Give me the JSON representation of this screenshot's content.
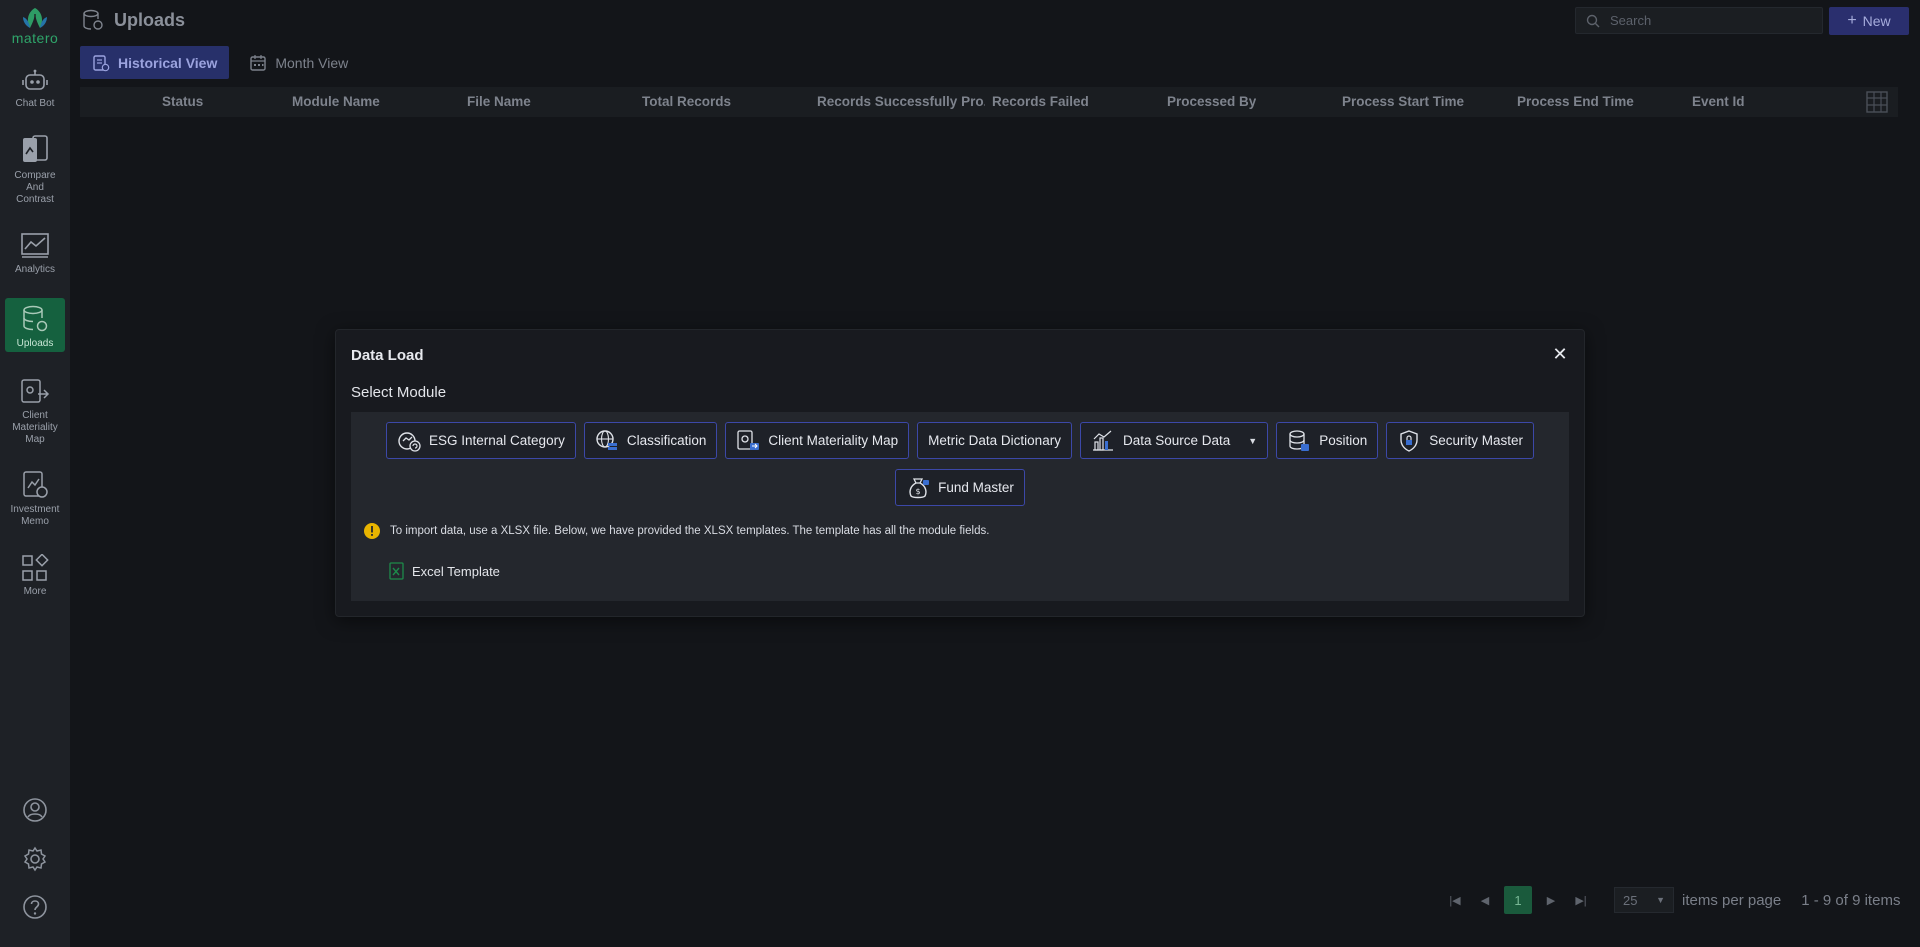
{
  "app": {
    "logo_text": "matero"
  },
  "sidebar": {
    "items": [
      {
        "label": "Chat Bot"
      },
      {
        "label": "Compare And Contrast"
      },
      {
        "label": "Analytics"
      },
      {
        "label": "Uploads"
      },
      {
        "label": "Client Materiality Map"
      },
      {
        "label": "Investment Memo"
      },
      {
        "label": "More"
      }
    ],
    "active": "Uploads"
  },
  "header": {
    "title": "Uploads",
    "search_placeholder": "Search",
    "new_label": "New"
  },
  "tabs": [
    {
      "label": "Historical View",
      "active": true
    },
    {
      "label": "Month View",
      "active": false
    }
  ],
  "grid": {
    "columns": [
      "Status",
      "Module Name",
      "File Name",
      "Total Records",
      "Records Successfully Pro...",
      "Records Failed",
      "Processed By",
      "Process Start Time",
      "Process End Time",
      "Event Id"
    ]
  },
  "pager": {
    "current_page": "1",
    "page_size": "25",
    "items_per_page_label": "items per page",
    "range_label": "1 - 9 of 9 items"
  },
  "modal": {
    "title": "Data Load",
    "subtitle": "Select Module",
    "modules_row1": [
      {
        "label": "ESG Internal Category",
        "icon": "category-sync-icon"
      },
      {
        "label": "Classification",
        "icon": "globe-stack-icon"
      },
      {
        "label": "Client Materiality Map",
        "icon": "client-map-icon"
      },
      {
        "label": "Metric Data Dictionary",
        "icon": ""
      },
      {
        "label": "Data Source Data",
        "icon": "chart-bars-icon",
        "dropdown": true
      },
      {
        "label": "Position",
        "icon": "database-icon"
      },
      {
        "label": "Security Master",
        "icon": "shield-lock-icon"
      }
    ],
    "modules_row2": [
      {
        "label": "Fund Master",
        "icon": "money-bag-icon"
      }
    ],
    "info_text": "To import data, use a XLSX file. Below, we have provided the XLSX templates. The template has all the module fields.",
    "template_label": "Excel Template"
  },
  "colors": {
    "background": "#131519",
    "sidebar": "#1e2126",
    "accent_green": "#15613f",
    "accent_blue": "#27306a",
    "module_border": "#3c48a8",
    "info_yellow": "#e8b400",
    "excel_green": "#1d8a4a"
  }
}
